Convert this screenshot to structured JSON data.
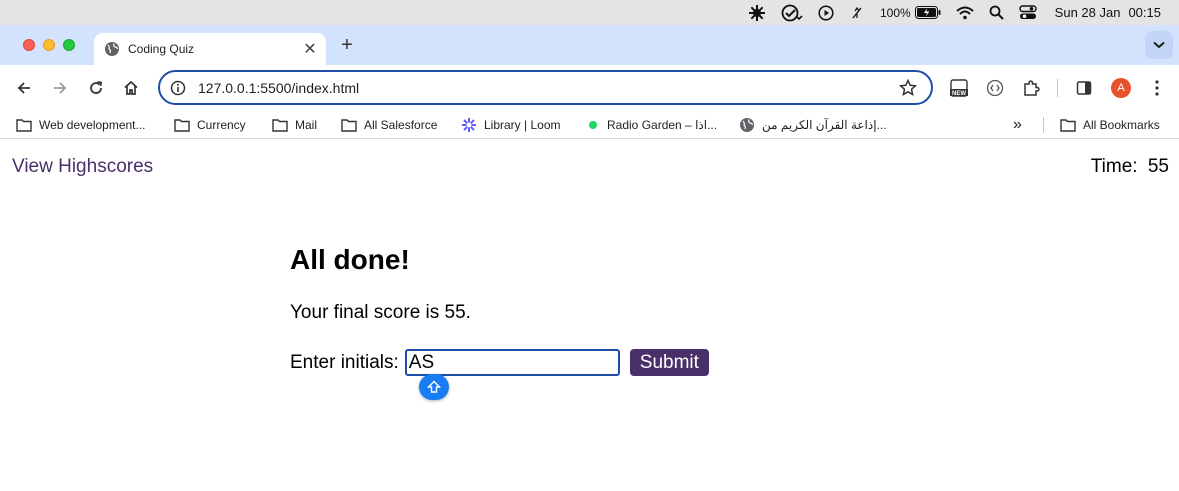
{
  "menubar": {
    "battery_percent": "100%",
    "date": "Sun 28 Jan",
    "time": "00:15",
    "icons": [
      "app-icon",
      "check-badge-icon",
      "play-icon",
      "mute-icon",
      "battery-icon",
      "wifi-icon",
      "search-icon",
      "control-center-icon"
    ]
  },
  "tab": {
    "title": "Coding Quiz",
    "close": "✕"
  },
  "newtab": "+",
  "omnibox": {
    "url": "127.0.0.1:5500/index.html"
  },
  "profile": {
    "initial": "A",
    "color": "#e5532d"
  },
  "bookmarks": {
    "items": [
      {
        "label": "Web development...",
        "icon": "folder-icon"
      },
      {
        "label": "Currency",
        "icon": "folder-icon"
      },
      {
        "label": "Mail",
        "icon": "folder-icon"
      },
      {
        "label": "All Salesforce",
        "icon": "folder-icon"
      },
      {
        "label": "Library | Loom",
        "icon": "loom-icon"
      },
      {
        "label": "Radio Garden – اذا...",
        "icon": "radio-dot-icon"
      },
      {
        "label": "إذاعة القرآن الكريم من...",
        "icon": "globe-icon"
      }
    ],
    "overflow": "»",
    "all_bookmarks": "All Bookmarks"
  },
  "page": {
    "highscores_link": "View Highscores",
    "timer_label": "Time:",
    "timer_value": "55",
    "title": "All done!",
    "final_score_text": "Your final score is 55.",
    "initials_label": "Enter initials:",
    "initials_value": "AS",
    "submit_label": "Submit",
    "accent_color": "#4a3069"
  }
}
